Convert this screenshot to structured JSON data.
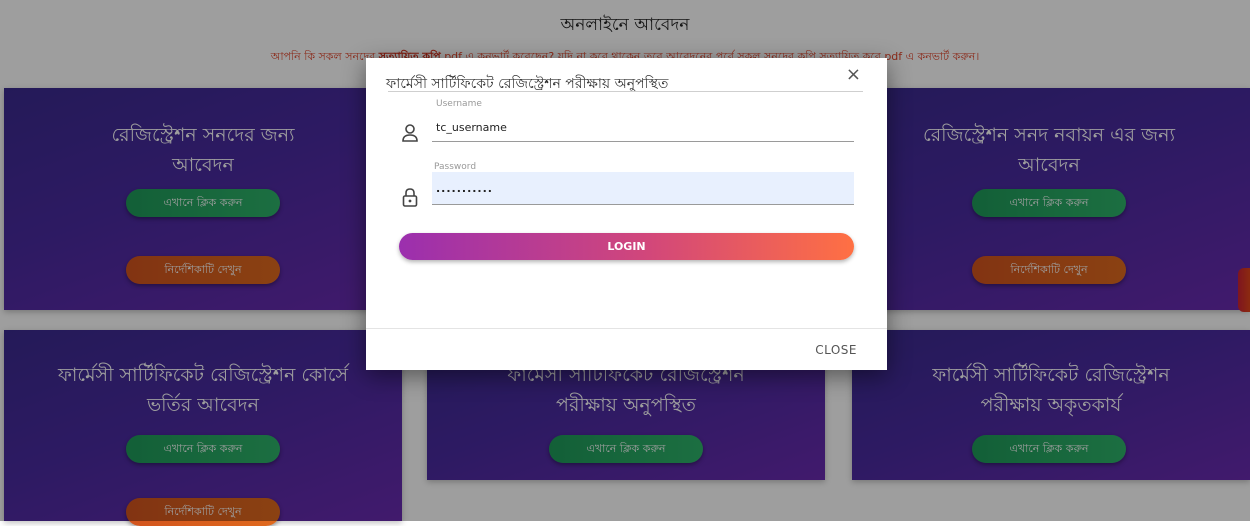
{
  "page": {
    "title": "অনলাইনে আবেদন",
    "notice_part1": "আপনি কি সকল সনদের ",
    "notice_bold": "সত্যায়িত কপি",
    "notice_part2": " pdf এ কনভার্ট করেছেন? যদি না করে থাকেন তবে আবেদনের পূর্বে সকল সনদের কপি সত্যায়িত করে pdf এ কনভার্ট করুন।"
  },
  "cards": [
    {
      "title_line1": "রেজিস্ট্রেশন সনদের জন্য",
      "title_line2": "আবেদন",
      "primary_label": "এখানে ক্লিক করুন",
      "guide_label": "নির্দেশিকাটি দেখুন"
    },
    {
      "title_line1": "রেজিস্ট্রেশন সনদ নবায়ন এর জন্য",
      "title_line2": "আবেদন",
      "primary_label": "এখানে ক্লিক করুন",
      "guide_label": "নির্দেশিকাটি দেখুন"
    },
    {
      "title_line1": "ফার্মেসী সার্টিফিকেট রেজিস্ট্রেশন কোর্সে",
      "title_line2": "ভর্তির আবেদন",
      "primary_label": "এখানে ক্লিক করুন",
      "guide_label": "নির্দেশিকাটি দেখুন"
    },
    {
      "title_line1": "ফার্মেসী সার্টিফিকেট রেজিস্ট্রেশন",
      "title_line2": "পরীক্ষায় অনুপস্থিত",
      "primary_label": "এখানে ক্লিক করুন"
    },
    {
      "title_line1": "ফার্মেসী সার্টিফিকেট রেজিস্ট্রেশন",
      "title_line2": "পরীক্ষায় অকৃতকার্য",
      "primary_label": "এখানে ক্লিক করুন"
    }
  ],
  "modal": {
    "title": "ফার্মেসী সার্টিফিকেট রেজিস্ট্রেশন পরীক্ষায় অনুপস্থিত",
    "close_x": "×",
    "username_label": "Username",
    "username_value": "tc_username",
    "password_label": "Password",
    "password_value": "...........",
    "login_label": "LOGIN",
    "close_label": "CLOSE",
    "icons": {
      "username": "user-icon",
      "password": "lock-icon"
    }
  },
  "colors": {
    "card_gradient_start": "#3b2a8f",
    "card_gradient_end": "#6a2ab0",
    "button_green": "#2eb36a",
    "button_orange": "#e06a1e",
    "login_gradient_start": "#9b2fae",
    "login_gradient_end": "#ff7043",
    "notice_red": "#e0442a",
    "password_field_bg": "#e8f0fe"
  }
}
